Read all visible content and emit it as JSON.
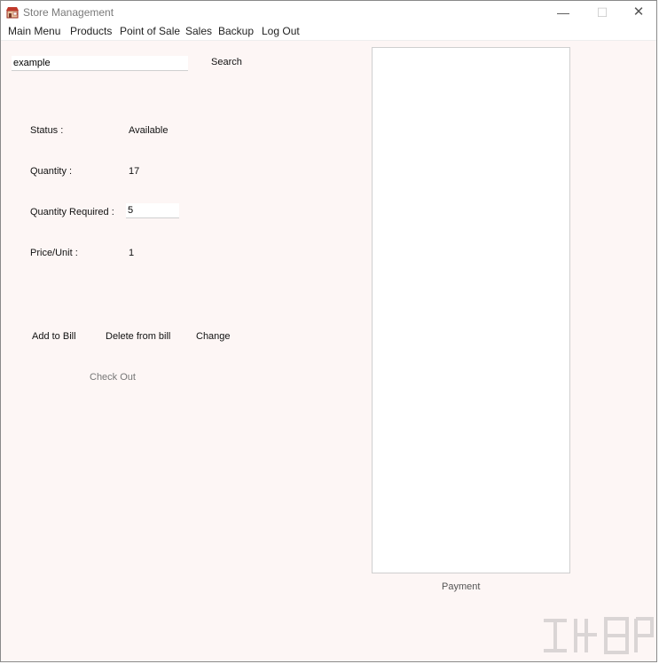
{
  "window": {
    "title": "Store Management",
    "controls": {
      "minimize": "—",
      "maximize": "☐",
      "close": "✕"
    }
  },
  "menu": [
    "Main Menu",
    "Products",
    "Point of Sale",
    "Sales",
    "Backup",
    "Log Out"
  ],
  "search": {
    "value": "example",
    "button": "Search"
  },
  "details": {
    "status_label": "Status :",
    "status_value": "Available",
    "quantity_label": "Quantity :",
    "quantity_value": "17",
    "quantity_required_label": "Quantity Required :",
    "quantity_required_value": "5",
    "price_label": "Price/Unit :",
    "price_value": "1"
  },
  "actions": {
    "add": "Add to Bill",
    "delete": "Delete from bill",
    "change": "Change",
    "checkout": "Check Out"
  },
  "payment": "Payment",
  "icons": {
    "app": "store-icon",
    "watermark": "watermark-logo"
  }
}
